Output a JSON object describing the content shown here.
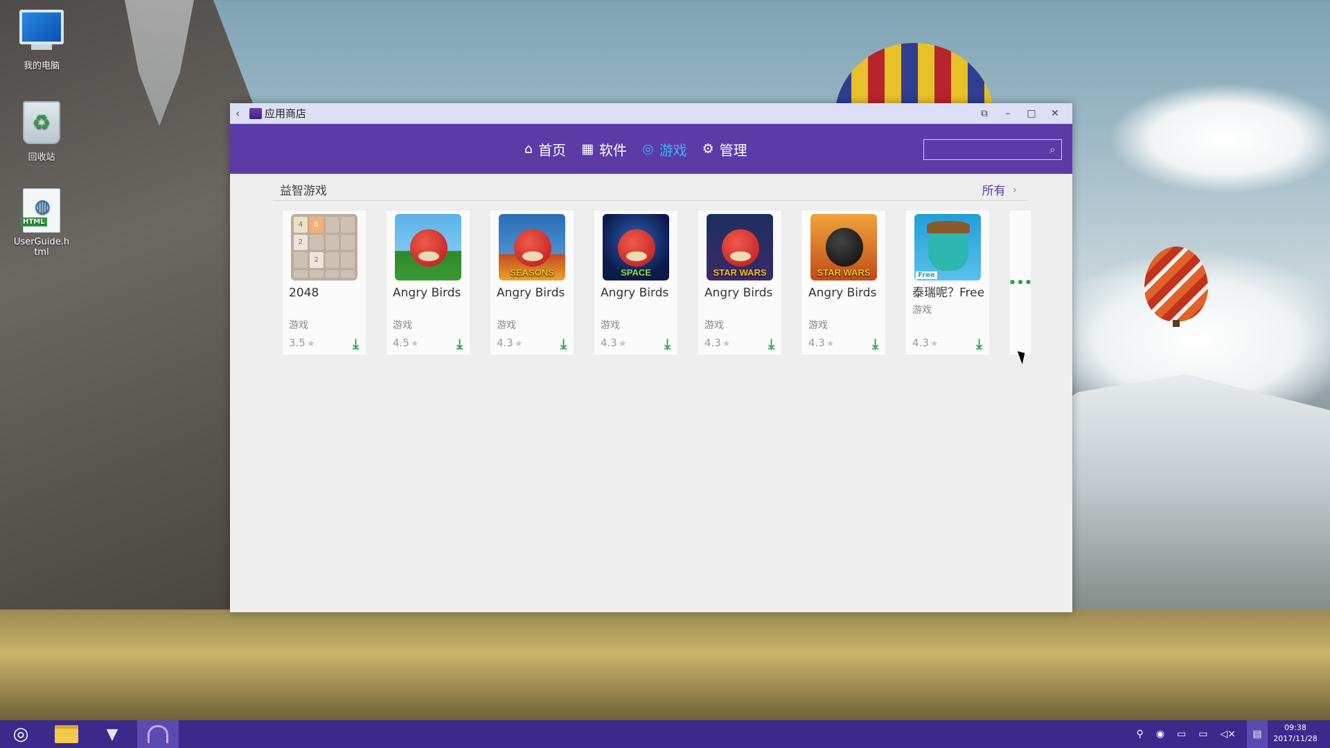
{
  "desktop": {
    "icons": [
      {
        "label": "我的电脑",
        "icon": "computer-icon"
      },
      {
        "label": "回收站",
        "icon": "recycle-bin-icon"
      },
      {
        "label": "UserGuide.html",
        "icon": "html-file-icon",
        "badge": "HTML"
      }
    ]
  },
  "window": {
    "back_glyph": "‹",
    "title": "应用商店",
    "controls": {
      "pin": "⧉",
      "minimize": "–",
      "maximize": "□",
      "close": "✕"
    }
  },
  "nav": {
    "items": [
      {
        "label": "首页",
        "icon": "home-icon",
        "glyph": "⌂",
        "active": false
      },
      {
        "label": "软件",
        "icon": "grid-icon",
        "glyph": "▦",
        "active": false
      },
      {
        "label": "游戏",
        "icon": "gamepad-icon",
        "glyph": "◎",
        "active": true
      },
      {
        "label": "管理",
        "icon": "gear-icon",
        "glyph": "⚙",
        "active": false
      }
    ],
    "search": {
      "placeholder": "",
      "icon": "search-icon",
      "glyph": "⌕"
    }
  },
  "section": {
    "title": "益智游戏",
    "all_label": "所有",
    "chevron": "›"
  },
  "apps": [
    {
      "name": "2048",
      "category": "游戏",
      "rating": "3.5",
      "icon": "2048-icon"
    },
    {
      "name": "Angry Birds",
      "category": "游戏",
      "rating": "4.5",
      "icon": "angry-birds-rio-icon"
    },
    {
      "name": "Angry Birds",
      "category": "游戏",
      "rating": "4.3",
      "icon": "angry-birds-seasons-icon",
      "icon_text": "SEASONS"
    },
    {
      "name": "Angry Birds",
      "category": "游戏",
      "rating": "4.3",
      "icon": "angry-birds-space-icon",
      "icon_text": "SPACE"
    },
    {
      "name": "Angry Birds",
      "category": "游戏",
      "rating": "4.3",
      "icon": "angry-birds-star-wars-hd-icon",
      "icon_text": "STAR WARS"
    },
    {
      "name": "Angry Birds",
      "category": "游戏",
      "rating": "4.3",
      "icon": "angry-birds-star-wars-icon",
      "icon_text": "STAR WARS"
    },
    {
      "name": "泰瑞呢？Free",
      "category": "游戏",
      "rating": "4.3",
      "icon": "where-is-perry-icon",
      "icon_text": "Free"
    }
  ],
  "more_glyph": "•••",
  "star_glyph": "★",
  "download_glyph": "⤓",
  "taskbar": {
    "start_glyph": "◎",
    "clock_time": "09:38",
    "clock_date": "2017/11/28"
  },
  "colors": {
    "nav_bg": "#5c3ba6",
    "nav_active": "#39b6f2",
    "download_green": "#2aa44a",
    "taskbar_bg": "#3b2a8c"
  }
}
